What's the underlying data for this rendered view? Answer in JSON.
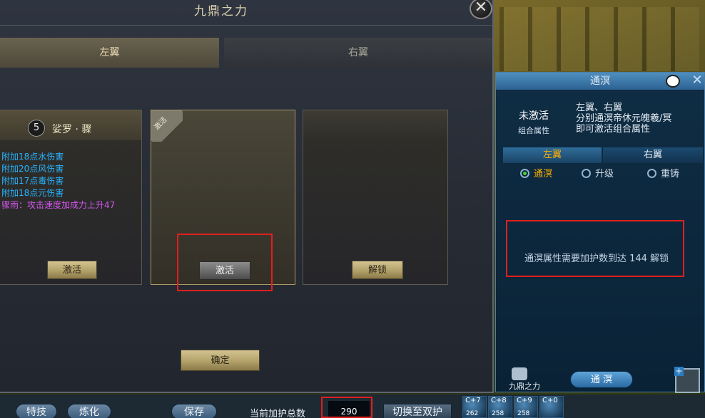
{
  "window": {
    "title": "九鼎之力",
    "close_icon": "✕"
  },
  "tabs": {
    "left": "左翼",
    "right": "右翼"
  },
  "cards": [
    {
      "level": "5",
      "name": "娑罗 · 骤",
      "attributes": [
        "附加18点水伤害",
        "附加20点风伤害",
        "附加17点毒伤害",
        "附加18点元伤害"
      ],
      "special": "骤雨：攻击速度加成力上升47",
      "button": "激活"
    },
    {
      "ribbon": "激活",
      "button": "激活"
    },
    {
      "button": "解锁"
    }
  ],
  "confirm_button": "确定",
  "right_panel": {
    "title": "通溟",
    "status": "未激活",
    "status_sub": "组合属性",
    "desc_line1": "左翼、右翼",
    "desc_line2": "分别通溟帝休元魄羲/冥",
    "desc_line3": "即可激活组合属性",
    "tabs": {
      "left": "左翼",
      "right": "右翼"
    },
    "radios": [
      {
        "label": "通溟",
        "selected": true
      },
      {
        "label": "升级",
        "selected": false
      },
      {
        "label": "重铸",
        "selected": false
      }
    ],
    "message": "通溟属性需要加护数到达  144  解锁",
    "bottom_label": "九鼎之力",
    "bottom_button": "通  溟"
  },
  "bottom_bar": {
    "btn1": "特技",
    "btn2": "炼化",
    "btn3": "保存",
    "label": "当前加护总数",
    "total": "290",
    "switch": "切换至双护",
    "skills": [
      {
        "top": "C+7",
        "bottom": "262"
      },
      {
        "top": "C+8",
        "bottom": "258"
      },
      {
        "top": "C+9",
        "bottom": "258"
      },
      {
        "top": "C+0",
        "bottom": ""
      }
    ]
  },
  "colors": {
    "attr_blue": "#27b4ff",
    "attr_purple": "#d357ee",
    "highlight_red": "#e0201c",
    "tab_gold": "#ffb000"
  }
}
